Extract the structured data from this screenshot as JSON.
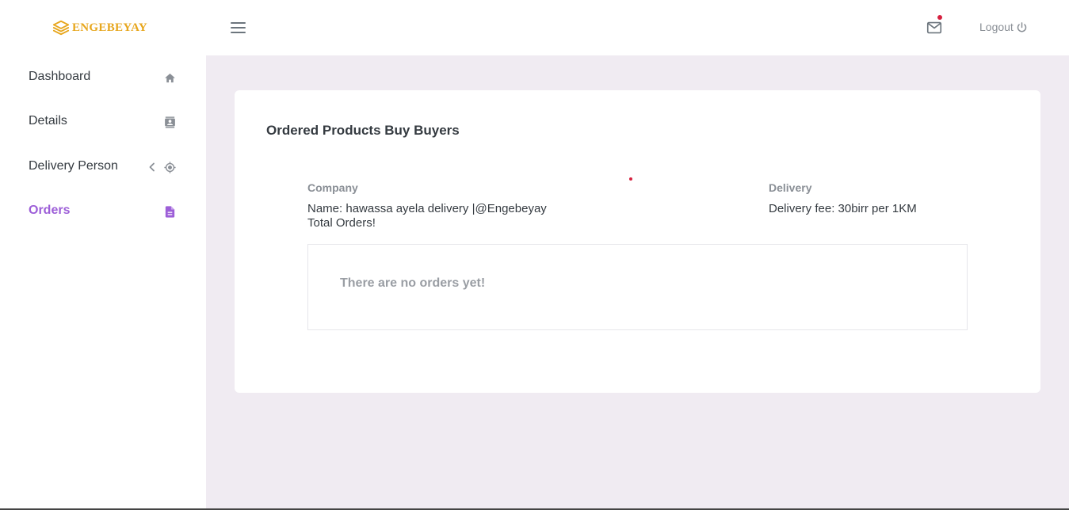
{
  "brand": {
    "name": "ENGEBEYAY",
    "color": "#e7a61c"
  },
  "header": {
    "menu_icon": "hamburger-icon",
    "mail_icon": "mail-icon",
    "logout_label": "Logout",
    "logout_icon": "power-icon"
  },
  "sidebar": {
    "items": [
      {
        "label": "Dashboard",
        "icon": "home-icon",
        "active": false
      },
      {
        "label": "Details",
        "icon": "contact-card-icon",
        "active": false
      },
      {
        "label": "Delivery Person",
        "icon": "target-icon",
        "active": false,
        "expandable": true
      },
      {
        "label": "Orders",
        "icon": "document-icon",
        "active": true
      }
    ],
    "active_color": "#9d5fd8"
  },
  "main": {
    "title": "Ordered Products Buy Buyers",
    "company": {
      "heading": "Company",
      "name_line": "Name: hawassa ayela delivery |@Engebeyay",
      "orders_line": "Total Orders!"
    },
    "delivery": {
      "heading": "Delivery",
      "fee_line": "Delivery fee: 30birr per 1KM"
    },
    "empty_message": "There are no orders yet!"
  },
  "colors": {
    "background": "#f0ebf2",
    "badge": "#d6203f"
  }
}
